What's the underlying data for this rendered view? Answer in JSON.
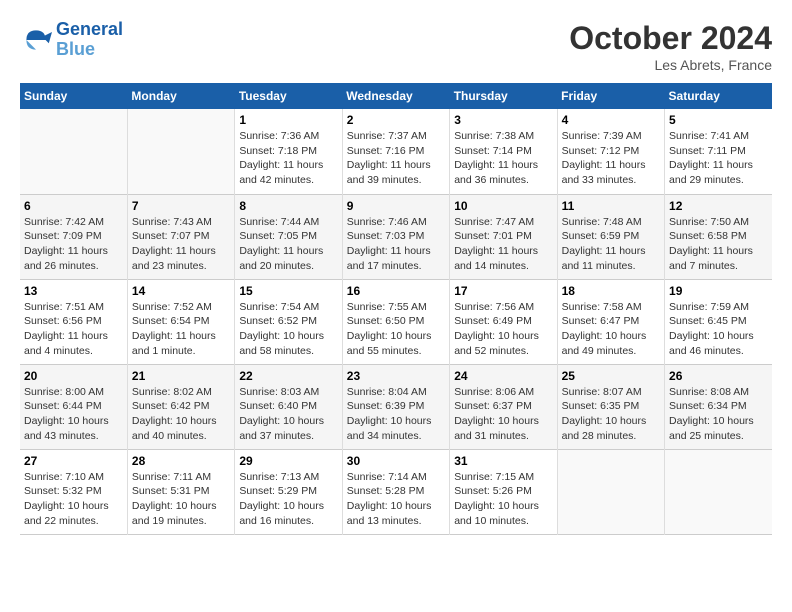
{
  "header": {
    "logo_line1": "General",
    "logo_line2": "Blue",
    "month": "October 2024",
    "location": "Les Abrets, France"
  },
  "days_of_week": [
    "Sunday",
    "Monday",
    "Tuesday",
    "Wednesday",
    "Thursday",
    "Friday",
    "Saturday"
  ],
  "weeks": [
    [
      {
        "num": "",
        "detail": ""
      },
      {
        "num": "",
        "detail": ""
      },
      {
        "num": "1",
        "detail": "Sunrise: 7:36 AM\nSunset: 7:18 PM\nDaylight: 11 hours and 42 minutes."
      },
      {
        "num": "2",
        "detail": "Sunrise: 7:37 AM\nSunset: 7:16 PM\nDaylight: 11 hours and 39 minutes."
      },
      {
        "num": "3",
        "detail": "Sunrise: 7:38 AM\nSunset: 7:14 PM\nDaylight: 11 hours and 36 minutes."
      },
      {
        "num": "4",
        "detail": "Sunrise: 7:39 AM\nSunset: 7:12 PM\nDaylight: 11 hours and 33 minutes."
      },
      {
        "num": "5",
        "detail": "Sunrise: 7:41 AM\nSunset: 7:11 PM\nDaylight: 11 hours and 29 minutes."
      }
    ],
    [
      {
        "num": "6",
        "detail": "Sunrise: 7:42 AM\nSunset: 7:09 PM\nDaylight: 11 hours and 26 minutes."
      },
      {
        "num": "7",
        "detail": "Sunrise: 7:43 AM\nSunset: 7:07 PM\nDaylight: 11 hours and 23 minutes."
      },
      {
        "num": "8",
        "detail": "Sunrise: 7:44 AM\nSunset: 7:05 PM\nDaylight: 11 hours and 20 minutes."
      },
      {
        "num": "9",
        "detail": "Sunrise: 7:46 AM\nSunset: 7:03 PM\nDaylight: 11 hours and 17 minutes."
      },
      {
        "num": "10",
        "detail": "Sunrise: 7:47 AM\nSunset: 7:01 PM\nDaylight: 11 hours and 14 minutes."
      },
      {
        "num": "11",
        "detail": "Sunrise: 7:48 AM\nSunset: 6:59 PM\nDaylight: 11 hours and 11 minutes."
      },
      {
        "num": "12",
        "detail": "Sunrise: 7:50 AM\nSunset: 6:58 PM\nDaylight: 11 hours and 7 minutes."
      }
    ],
    [
      {
        "num": "13",
        "detail": "Sunrise: 7:51 AM\nSunset: 6:56 PM\nDaylight: 11 hours and 4 minutes."
      },
      {
        "num": "14",
        "detail": "Sunrise: 7:52 AM\nSunset: 6:54 PM\nDaylight: 11 hours and 1 minute."
      },
      {
        "num": "15",
        "detail": "Sunrise: 7:54 AM\nSunset: 6:52 PM\nDaylight: 10 hours and 58 minutes."
      },
      {
        "num": "16",
        "detail": "Sunrise: 7:55 AM\nSunset: 6:50 PM\nDaylight: 10 hours and 55 minutes."
      },
      {
        "num": "17",
        "detail": "Sunrise: 7:56 AM\nSunset: 6:49 PM\nDaylight: 10 hours and 52 minutes."
      },
      {
        "num": "18",
        "detail": "Sunrise: 7:58 AM\nSunset: 6:47 PM\nDaylight: 10 hours and 49 minutes."
      },
      {
        "num": "19",
        "detail": "Sunrise: 7:59 AM\nSunset: 6:45 PM\nDaylight: 10 hours and 46 minutes."
      }
    ],
    [
      {
        "num": "20",
        "detail": "Sunrise: 8:00 AM\nSunset: 6:44 PM\nDaylight: 10 hours and 43 minutes."
      },
      {
        "num": "21",
        "detail": "Sunrise: 8:02 AM\nSunset: 6:42 PM\nDaylight: 10 hours and 40 minutes."
      },
      {
        "num": "22",
        "detail": "Sunrise: 8:03 AM\nSunset: 6:40 PM\nDaylight: 10 hours and 37 minutes."
      },
      {
        "num": "23",
        "detail": "Sunrise: 8:04 AM\nSunset: 6:39 PM\nDaylight: 10 hours and 34 minutes."
      },
      {
        "num": "24",
        "detail": "Sunrise: 8:06 AM\nSunset: 6:37 PM\nDaylight: 10 hours and 31 minutes."
      },
      {
        "num": "25",
        "detail": "Sunrise: 8:07 AM\nSunset: 6:35 PM\nDaylight: 10 hours and 28 minutes."
      },
      {
        "num": "26",
        "detail": "Sunrise: 8:08 AM\nSunset: 6:34 PM\nDaylight: 10 hours and 25 minutes."
      }
    ],
    [
      {
        "num": "27",
        "detail": "Sunrise: 7:10 AM\nSunset: 5:32 PM\nDaylight: 10 hours and 22 minutes."
      },
      {
        "num": "28",
        "detail": "Sunrise: 7:11 AM\nSunset: 5:31 PM\nDaylight: 10 hours and 19 minutes."
      },
      {
        "num": "29",
        "detail": "Sunrise: 7:13 AM\nSunset: 5:29 PM\nDaylight: 10 hours and 16 minutes."
      },
      {
        "num": "30",
        "detail": "Sunrise: 7:14 AM\nSunset: 5:28 PM\nDaylight: 10 hours and 13 minutes."
      },
      {
        "num": "31",
        "detail": "Sunrise: 7:15 AM\nSunset: 5:26 PM\nDaylight: 10 hours and 10 minutes."
      },
      {
        "num": "",
        "detail": ""
      },
      {
        "num": "",
        "detail": ""
      }
    ]
  ]
}
